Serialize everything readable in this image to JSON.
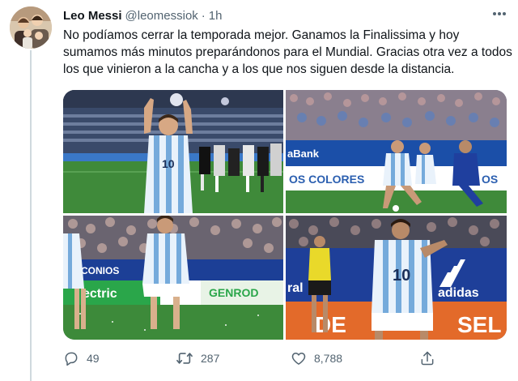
{
  "tweet": {
    "author_name": "Leo Messi",
    "handle": "@leomessiok",
    "separator": "·",
    "time": "1h",
    "text": "No podíamos cerrar la temporada mejor. Ganamos la Finalissima y hoy sumamos más minutos preparándonos para el Mundial. Gracias otra vez a todos los que vinieron a la cancha y a los que nos siguen desde la distancia.",
    "more_icon": "more-icon"
  },
  "photos": [
    {
      "jersey_number": "10"
    },
    {
      "banner_left": "aBank",
      "banner_mid": "OS COLORES",
      "banner_right": "OS"
    },
    {
      "banner_top": "CONIOS",
      "banner_bottom": "ectric",
      "banner_right": "GENROD"
    },
    {
      "jersey_number": "10",
      "banner_left": "ral",
      "banner_right": "adidas",
      "banner_bottom": "DE",
      "banner_bottom_right": "SEL"
    }
  ],
  "actions": {
    "reply_count": "49",
    "retweet_count": "287",
    "like_count": "8,788",
    "icons": [
      "reply-icon",
      "retweet-icon",
      "like-icon",
      "share-icon"
    ]
  },
  "colors": {
    "text_primary": "#0f1419",
    "text_secondary": "#536471",
    "argentina_blue": "#75aadb",
    "pitch_green": "#3f8a3a"
  }
}
